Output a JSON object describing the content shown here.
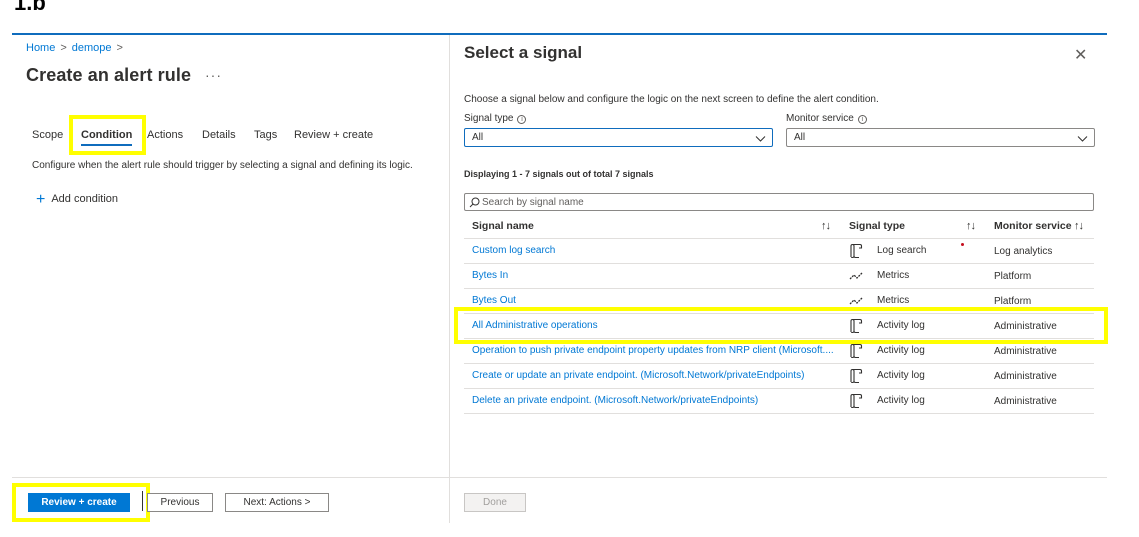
{
  "step_label": "1.b",
  "left": {
    "breadcrumb": [
      "Home",
      "demope"
    ],
    "title": "Create an alert rule",
    "more": "···",
    "tabs": [
      "Scope",
      "Condition",
      "Actions",
      "Details",
      "Tags",
      "Review + create"
    ],
    "active_tab": "Condition",
    "description": "Configure when the alert rule should trigger by selecting a signal and defining its logic.",
    "add_condition": "Add condition",
    "footer": {
      "review_create": "Review + create",
      "previous": "Previous",
      "next": "Next: Actions >"
    }
  },
  "blade": {
    "title": "Select a signal",
    "close": "✕",
    "description": "Choose a signal below and configure the logic on the next screen to define the alert condition.",
    "signal_type_label": "Signal type",
    "signal_type_value": "All",
    "monitor_service_label": "Monitor service",
    "monitor_service_value": "All",
    "displaying": "Displaying 1 - 7 signals out of total 7 signals",
    "search_placeholder": "Search by signal name",
    "columns": {
      "name": "Signal name",
      "type": "Signal type",
      "service": "Monitor service"
    },
    "sort_glyph": "↑↓",
    "rows": [
      {
        "name": "Custom log search",
        "type": "Log search",
        "service": "Log analytics",
        "icon": "log-search-icon"
      },
      {
        "name": "Bytes In",
        "type": "Metrics",
        "service": "Platform",
        "icon": "metrics-icon"
      },
      {
        "name": "Bytes Out",
        "type": "Metrics",
        "service": "Platform",
        "icon": "metrics-icon"
      },
      {
        "name": "All Administrative operations",
        "type": "Activity log",
        "service": "Administrative",
        "icon": "activity-log-icon"
      },
      {
        "name": "Operation to push private endpoint property updates from NRP client (Microsoft....",
        "type": "Activity log",
        "service": "Administrative",
        "icon": "activity-log-icon"
      },
      {
        "name": "Create or update an private endpoint. (Microsoft.Network/privateEndpoints)",
        "type": "Activity log",
        "service": "Administrative",
        "icon": "activity-log-icon"
      },
      {
        "name": "Delete an private endpoint. (Microsoft.Network/privateEndpoints)",
        "type": "Activity log",
        "service": "Administrative",
        "icon": "activity-log-icon"
      }
    ],
    "done": "Done"
  },
  "colors": {
    "accent": "#0078d4",
    "highlight": "#ffff00",
    "text": "#323130"
  }
}
